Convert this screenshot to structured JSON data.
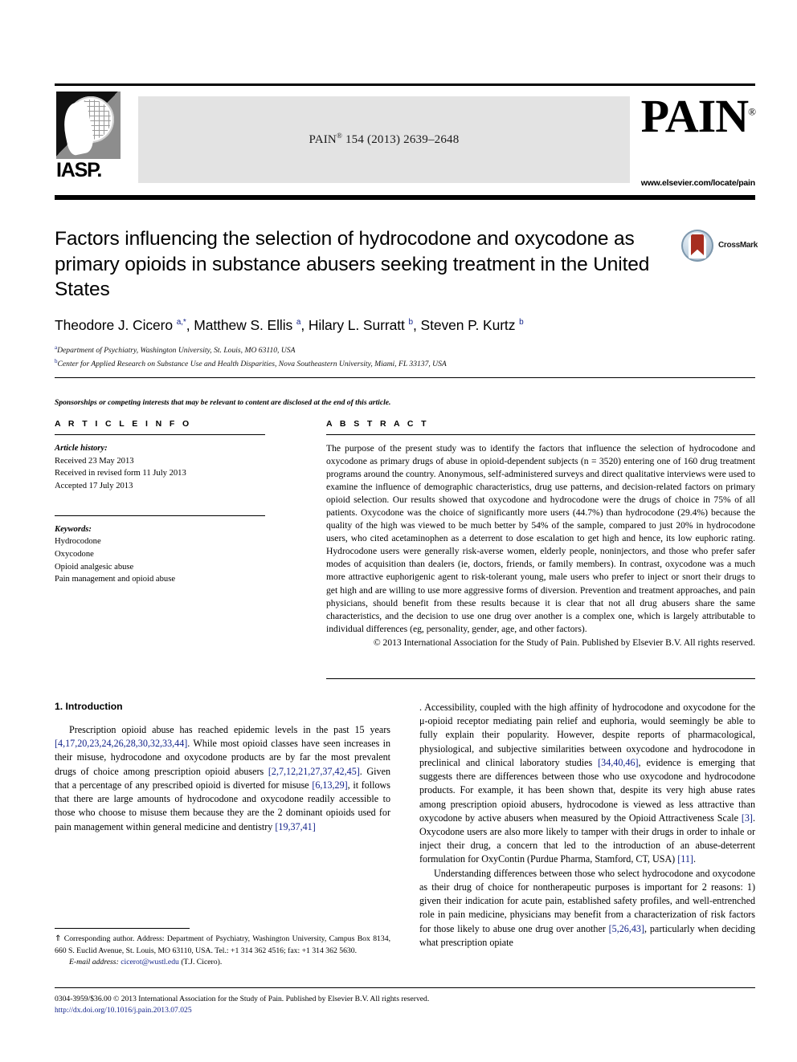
{
  "masthead": {
    "logo_text": "IASP.",
    "logo_icon": "iasp-globe-hand-logo",
    "citation_prefix": "PAIN",
    "citation_mark": "®",
    "citation_rest": " 154 (2013) 2639–2648",
    "journal_logo": "PAIN",
    "journal_logo_mark": "®",
    "publisher_url": "www.elsevier.com/locate/pain"
  },
  "article": {
    "title": "Factors influencing the selection of hydrocodone and oxycodone as primary opioids in substance abusers seeking treatment in the United States",
    "authors_html": "Theodore J. Cicero <sup>a,*</sup>, Matthew S. Ellis <sup>a</sup>, Hilary L. Surratt <sup>b</sup>, Steven P. Kurtz <sup>b</sup>",
    "affiliation_a": "Department of Psychiatry, Washington University, St. Louis, MO 63110, USA",
    "affiliation_b": "Center for Applied Research on Substance Use and Health Disparities, Nova Southeastern University, Miami, FL 33137, USA",
    "sponsorship_note": "Sponsorships or competing interests that may be relevant to content are disclosed at the end of this article."
  },
  "crossmark": {
    "label": "CrossMark",
    "icon": "crossmark-badge-icon"
  },
  "article_info": {
    "heading": "A R T I C L E   I N F O",
    "history_label": "Article history:",
    "history": [
      "Received 23 May 2013",
      "Received in revised form 11 July 2013",
      "Accepted 17 July 2013"
    ],
    "keywords_label": "Keywords:",
    "keywords": [
      "Hydrocodone",
      "Oxycodone",
      "Opioid analgesic abuse",
      "Pain management and opioid abuse"
    ]
  },
  "abstract": {
    "heading": "A B S T R A C T",
    "body": "The purpose of the present study was to identify the factors that influence the selection of hydrocodone and oxycodone as primary drugs of abuse in opioid-dependent subjects (n = 3520) entering one of 160 drug treatment programs around the country. Anonymous, self-administered surveys and direct qualitative interviews were used to examine the influence of demographic characteristics, drug use patterns, and decision-related factors on primary opioid selection. Our results showed that oxycodone and hydrocodone were the drugs of choice in 75% of all patients. Oxycodone was the choice of significantly more users (44.7%) than hydrocodone (29.4%) because the quality of the high was viewed to be much better by 54% of the sample, compared to just 20% in hydrocodone users, who cited acetaminophen as a deterrent to dose escalation to get high and hence, its low euphoric rating. Hydrocodone users were generally risk-averse women, elderly people, noninjectors, and those who prefer safer modes of acquisition than dealers (ie, doctors, friends, or family members). In contrast, oxycodone was a much more attractive euphorigenic agent to risk-tolerant young, male users who prefer to inject or snort their drugs to get high and are willing to use more aggressive forms of diversion. Prevention and treatment approaches, and pain physicians, should benefit from these results because it is clear that not all drug abusers share the same characteristics, and the decision to use one drug over another is a complex one, which is largely attributable to individual differences (eg, personality, gender, age, and other factors).",
    "copyright": "© 2013 International Association for the Study of Pain. Published by Elsevier B.V. All rights reserved."
  },
  "introduction": {
    "heading": "1. Introduction",
    "paragraph_1_parts": [
      "Prescription opioid abuse has reached epidemic levels in the past 15 years ",
      "[4,17,20,23,24,26,28,30,32,33,44]",
      ". While most opioid classes have seen increases in their misuse, hydrocodone and oxycodone products are by far the most prevalent drugs of choice among prescription opioid abusers ",
      "[2,7,12,21,27,37,42,45]",
      ". Given that a percentage of any prescribed opioid is diverted for misuse ",
      "[6,13,29]",
      ", it follows that there are large amounts of hydrocodone and oxycodone readily accessible to those who choose to misuse them because they are the 2 dominant opioids used for pain management within general medicine and dentistry ",
      "[19,37,41]",
      ". Accessibility, coupled with the high affinity of hydrocodone and oxycodone for the μ-opioid receptor mediating pain relief and euphoria, would seemingly be able to fully explain their popularity. However, despite reports of pharmacological, physiological, and subjective similarities between oxycodone and hydrocodone in preclinical and clinical laboratory studies ",
      "[34,40,46]",
      ", evidence is emerging that suggests there are differences between those who use oxycodone and hydrocodone products. For example, it has been shown that, despite its very high abuse rates among prescription opioid abusers, hydrocodone is viewed as less attractive than oxycodone by active abusers when measured by the Opioid Attractiveness Scale ",
      "[3]",
      ". Oxycodone users are also more likely to tamper with their drugs in order to inhale or inject their drug, a concern that led to the introduction of an abuse-deterrent formulation for OxyContin (Purdue Pharma, Stamford, CT, USA) ",
      "[11]",
      "."
    ],
    "paragraph_2_parts": [
      "Understanding differences between those who select hydrocodone and oxycodone as their drug of choice for nontherapeutic purposes is important for 2 reasons: 1) given their indication for acute pain, established safety profiles, and well-entrenched role in pain medicine, physicians may benefit from a characterization of risk factors for those likely to abuse one drug over another ",
      "[5,26,43]",
      ", particularly when deciding what prescription opiate"
    ]
  },
  "footnote": {
    "star": "⇑",
    "corresponding": " Corresponding author. Address: Department of Psychiatry, Washington University, Campus Box 8134, 660 S. Euclid Avenue, St. Louis, MO 63110, USA. Tel.: +1 314 362 4516; fax: +1 314 362 5630.",
    "email_label": "E-mail address:",
    "email": "cicerot@wustl.edu",
    "email_suffix": " (T.J. Cicero)."
  },
  "footer": {
    "issn_line": "0304-3959/$36.00 © 2013 International Association for the Study of Pain. Published by Elsevier B.V. All rights reserved.",
    "doi": "http://dx.doi.org/10.1016/j.pain.2013.07.025"
  },
  "colors": {
    "reference_link": "#14248a",
    "banner_gray": "#e3e3e3",
    "crossmark_red": "#a72e20"
  }
}
